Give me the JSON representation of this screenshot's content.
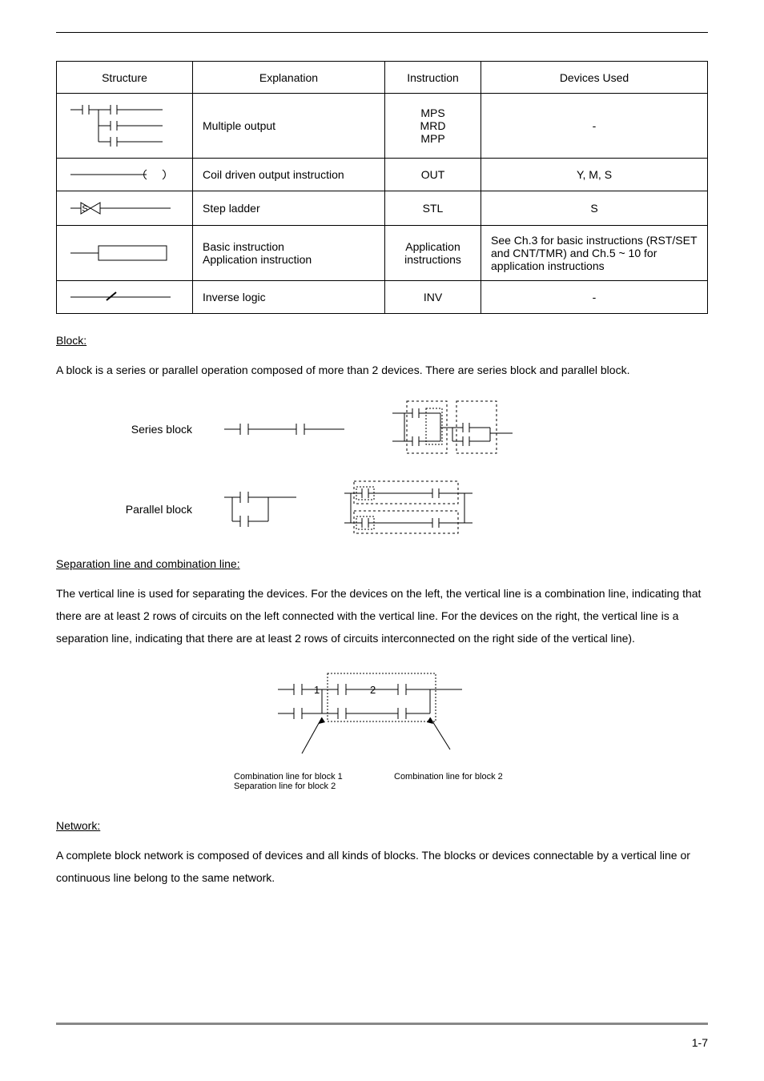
{
  "table": {
    "headers": [
      "Structure",
      "Explanation",
      "Instruction",
      "Devices Used"
    ],
    "rows": [
      {
        "explanation": "Multiple output",
        "instruction": "MPS\nMRD\nMPP",
        "devices": "-"
      },
      {
        "explanation": "Coil driven output instruction",
        "instruction": "OUT",
        "devices": "Y, M, S"
      },
      {
        "explanation": "Step ladder",
        "instruction": "STL",
        "devices": "S"
      },
      {
        "explanation": "Basic instruction\nApplication instruction",
        "instruction": "Application instructions",
        "devices": "See Ch.3 for basic instructions (RST/SET and CNT/TMR) and Ch.5 ~ 10 for application instructions"
      },
      {
        "explanation": "Inverse logic",
        "instruction": "INV",
        "devices": "-"
      }
    ]
  },
  "block": {
    "title": "Block:",
    "text": "A block is a series or parallel operation composed of more than 2 devices. There are series block and parallel block.",
    "series_label": "Series block",
    "parallel_label": "Parallel block"
  },
  "separation": {
    "title": "Separation line and combination line:",
    "text": "The vertical line is used for separating the devices. For the devices on the left, the vertical line is a combination line, indicating that there are at least 2 rows of circuits on the left connected with the vertical line. For the devices on the right, the vertical line is a separation line, indicating that there are at least 2 rows of circuits interconnected on the right side of the vertical line).",
    "n1": "1",
    "n2": "2",
    "label_left": "Combination line for block 1\nSeparation line for block 2",
    "label_right": "Combination line for block 2"
  },
  "network": {
    "title": "Network:",
    "text": "A complete block network is composed of devices and all kinds of blocks. The blocks or devices connectable by a vertical line or continuous line belong to the same network."
  },
  "page_number": "1-7"
}
